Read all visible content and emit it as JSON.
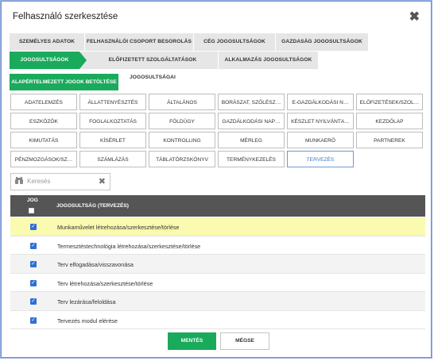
{
  "dialog": {
    "title": "Felhasználó szerkesztése",
    "close_glyph": "✖"
  },
  "tabs_row1": [
    {
      "label": "Személyes adatok"
    },
    {
      "label": "Felhasználói csoport besorolás"
    },
    {
      "label": "Cég jogosultságok"
    },
    {
      "label": "Gazdaság jogosultságok"
    }
  ],
  "tabs_row2": [
    {
      "label": "Jogosultságok",
      "active": true
    },
    {
      "label": "Előfizetett szolgáltatások jogosultságai"
    },
    {
      "label": "Alkalmazás jogosultságok"
    }
  ],
  "load_defaults_label": "Alapértelmezett jogok betöltése",
  "modules": [
    "Adatelemzés",
    "Állattenyésztés",
    "Általános",
    "Borászat, szőlész…",
    "E-gazdálkodási n…",
    "Előfizetések/szol…",
    "Eszközök",
    "Foglalkoztatás",
    "Földügy",
    "Gazdálkodási nap…",
    "Készlet nyilvántа…",
    "Kezdőlap",
    "Kimutatás",
    "Kísérlet",
    "Kontrolling",
    "Mérleg",
    "Munkaerő",
    "Partnerek",
    "Pénzmozgások/sz…",
    "Számlázás",
    "Táblatörzskönyv",
    "Terménykezelés",
    "Tervezés"
  ],
  "selected_module": "Tervezés",
  "search": {
    "placeholder": "Keresés",
    "icon": "binoculars-icon",
    "clear_glyph": "✖"
  },
  "table": {
    "col_jog": "JOG",
    "col_perm": "Jogosultság (Tervezés)",
    "rows": [
      {
        "label": "Munkaművelet létrehozása/szerkesztése/törlése",
        "checked": true,
        "highlight": true
      },
      {
        "label": "Termesztéstechnológia létrehozása/szerkesztése/törlése",
        "checked": true
      },
      {
        "label": "Terv elfogadása/visszavonása",
        "checked": true
      },
      {
        "label": "Terv létrehozása/szerkesztése/törlése",
        "checked": true
      },
      {
        "label": "Terv lezárása/feloldása",
        "checked": true
      },
      {
        "label": "Tervezés modul elérése",
        "checked": true
      }
    ]
  },
  "buttons": {
    "save": "Mentés",
    "cancel": "Mégse"
  },
  "colors": {
    "accent": "#1aaa5c",
    "header": "#555555",
    "highlight": "#fafab0",
    "checkbox": "#2f6fd6"
  }
}
